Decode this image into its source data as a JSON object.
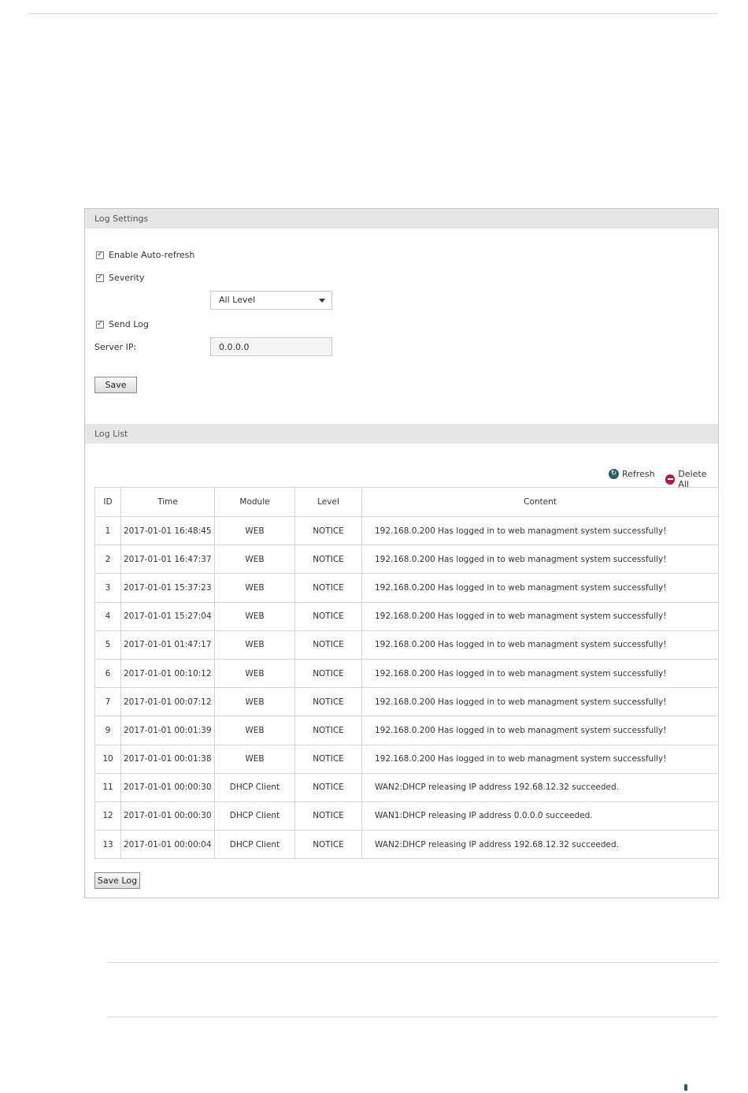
{
  "settings": {
    "header": "Log Settings",
    "auto_refresh_label": "Enable Auto-refresh",
    "severity_label": "Severity",
    "severity_value": "All Level",
    "send_log_label": "Send Log",
    "server_ip_label": "Server IP:",
    "server_ip_value": "0.0.0.0",
    "save_label": "Save"
  },
  "loglist": {
    "header": "Log List",
    "refresh_label": "Refresh",
    "delete_all_label": "Delete All",
    "columns": [
      "ID",
      "Time",
      "Module",
      "Level",
      "Content"
    ],
    "rows": [
      {
        "id": "1",
        "time": "2017-01-01 16:48:45",
        "module": "WEB",
        "level": "NOTICE",
        "content": "192.168.0.200 Has logged in to web managment system successfully!"
      },
      {
        "id": "2",
        "time": "2017-01-01 16:47:37",
        "module": "WEB",
        "level": "NOTICE",
        "content": "192.168.0.200 Has logged in to web managment system successfully!"
      },
      {
        "id": "3",
        "time": "2017-01-01 15:37:23",
        "module": "WEB",
        "level": "NOTICE",
        "content": "192.168.0.200 Has logged in to web managment system successfully!"
      },
      {
        "id": "4",
        "time": "2017-01-01 15:27:04",
        "module": "WEB",
        "level": "NOTICE",
        "content": "192.168.0.200 Has logged in to web managment system successfully!"
      },
      {
        "id": "5",
        "time": "2017-01-01 01:47:17",
        "module": "WEB",
        "level": "NOTICE",
        "content": "192.168.0.200 Has logged in to web managment system successfully!"
      },
      {
        "id": "6",
        "time": "2017-01-01 00:10:12",
        "module": "WEB",
        "level": "NOTICE",
        "content": "192.168.0.200 Has logged in to web managment system successfully!"
      },
      {
        "id": "7",
        "time": "2017-01-01 00:07:12",
        "module": "WEB",
        "level": "NOTICE",
        "content": "192.168.0.200 Has logged in to web managment system successfully!"
      },
      {
        "id": "9",
        "time": "2017-01-01 00:01:39",
        "module": "WEB",
        "level": "NOTICE",
        "content": "192.168.0.200 Has logged in to web managment system successfully!"
      },
      {
        "id": "10",
        "time": "2017-01-01 00:01:38",
        "module": "WEB",
        "level": "NOTICE",
        "content": "192.168.0.200 Has logged in to web managment system successfully!"
      },
      {
        "id": "11",
        "time": "2017-01-01 00:00:30",
        "module": "DHCP Client",
        "level": "NOTICE",
        "content": "WAN2:DHCP releasing IP address 192.68.12.32 succeeded."
      },
      {
        "id": "12",
        "time": "2017-01-01 00:00:30",
        "module": "DHCP Client",
        "level": "NOTICE",
        "content": "WAN1:DHCP releasing IP address 0.0.0.0 succeeded."
      },
      {
        "id": "13",
        "time": "2017-01-01 00:00:04",
        "module": "DHCP Client",
        "level": "NOTICE",
        "content": "WAN2:DHCP releasing IP address 192.68.12.32 succeeded."
      }
    ],
    "save_log_label": "Save Log"
  },
  "colors": {
    "header_bg": "#e6e6e6",
    "refresh_icon": "#2e5a6b",
    "delete_icon": "#b0185a"
  },
  "icons": {
    "refresh": "refresh-icon",
    "delete_all": "minus-circle-icon",
    "checkbox": "check-icon",
    "dropdown": "caret-down-icon"
  }
}
